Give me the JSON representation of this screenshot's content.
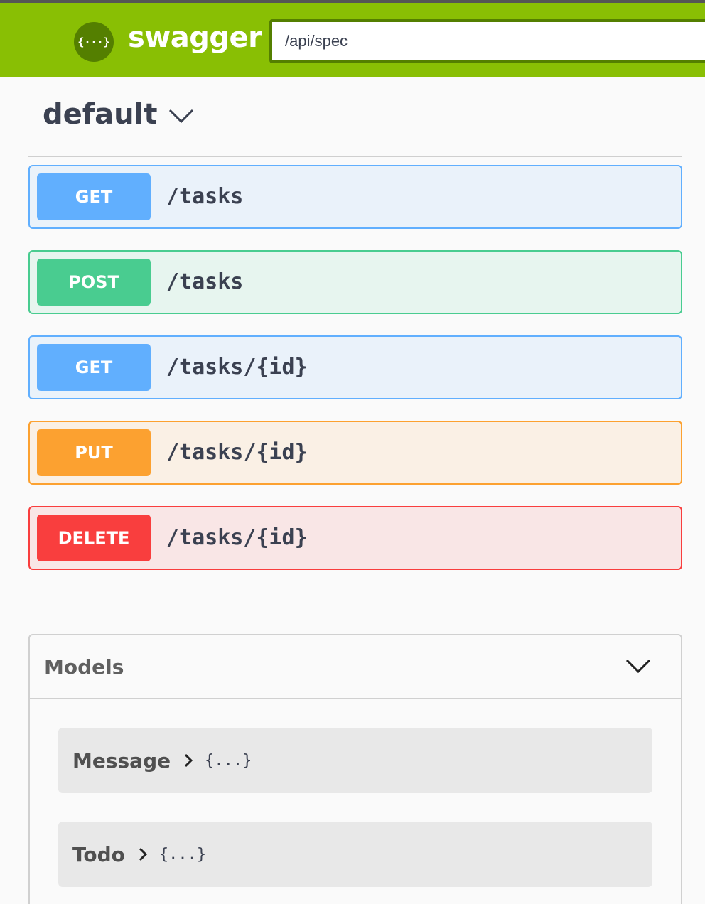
{
  "topbar": {
    "logo_glyph": "{···}",
    "logo_text": "swagger",
    "spec_url": "/api/spec",
    "bg_color": "#89bf04"
  },
  "section": {
    "title": "default",
    "icon": "chevron-down-icon"
  },
  "operations": [
    {
      "method": "GET",
      "path": "/tasks",
      "color": "#61affe"
    },
    {
      "method": "POST",
      "path": "/tasks",
      "color": "#49cc90"
    },
    {
      "method": "GET",
      "path": "/tasks/{id}",
      "color": "#61affe"
    },
    {
      "method": "PUT",
      "path": "/tasks/{id}",
      "color": "#fca130"
    },
    {
      "method": "DELETE",
      "path": "/tasks/{id}",
      "color": "#f93e3e"
    }
  ],
  "models": {
    "title": "Models",
    "icon": "chevron-down-icon",
    "items": [
      {
        "name": "Message",
        "collapsed": "{...}",
        "icon": "chevron-right-icon"
      },
      {
        "name": "Todo",
        "collapsed": "{...}",
        "icon": "chevron-right-icon"
      }
    ]
  }
}
